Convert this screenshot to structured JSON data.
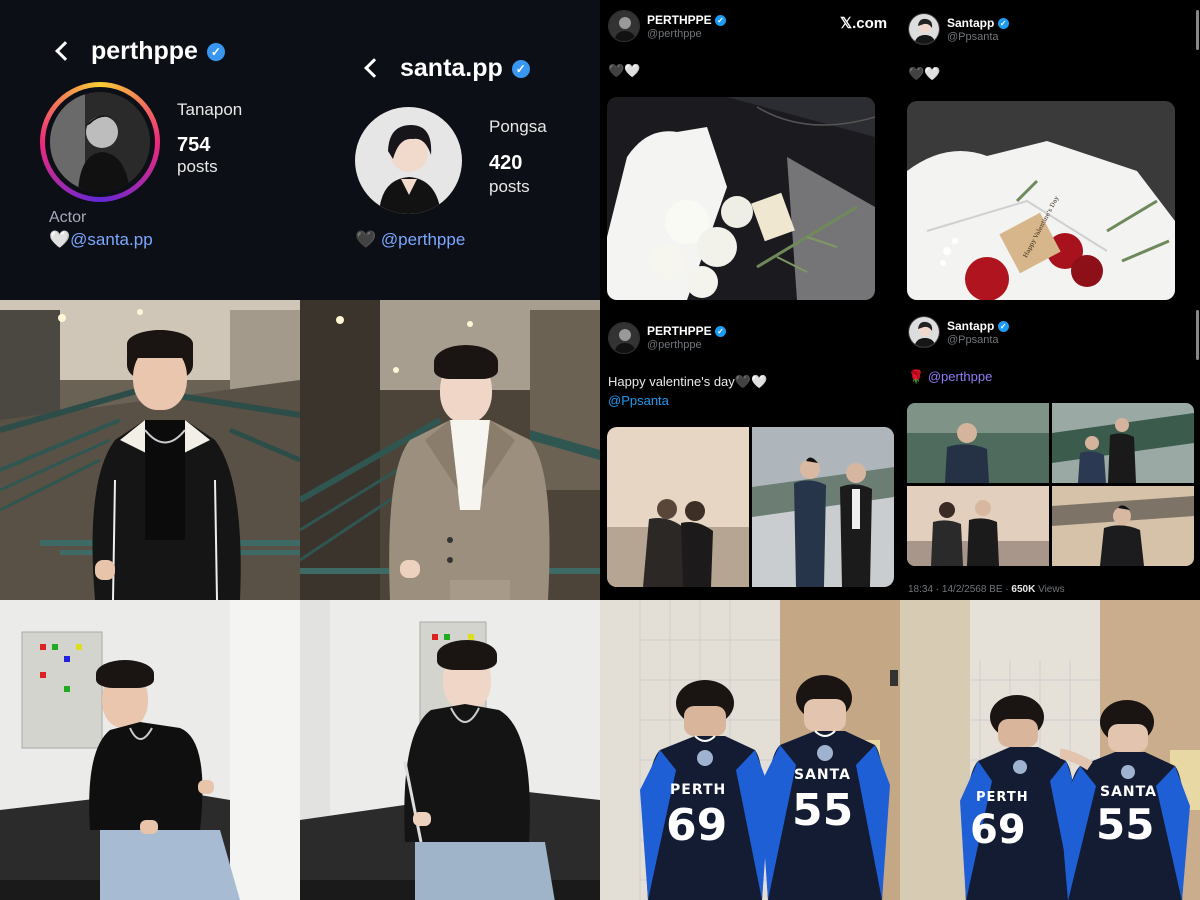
{
  "ig_left": {
    "username": "perthppe",
    "full_name": "Tanapon",
    "posts_count": "754",
    "posts_label": "posts",
    "bio": "Actor",
    "heart": "🤍",
    "mention": "@santa.pp"
  },
  "ig_right": {
    "username": "santa.pp",
    "full_name": "Pongsa",
    "posts_count": "420",
    "posts_label": "posts",
    "heart": "🖤",
    "mention": "@perthppe"
  },
  "tw_left": {
    "site_logo": "𝕏.com",
    "post1": {
      "name": "PERTHPPE",
      "handle": "@perthppe",
      "text": "🖤🤍"
    },
    "post2": {
      "name": "PERTHPPE",
      "handle": "@perthppe",
      "text": "Happy valentine's day🖤🤍",
      "link": "@Ppsanta"
    }
  },
  "tw_right": {
    "post1": {
      "name": "Santapp",
      "handle": "@Ppsanta",
      "text": "🖤🤍"
    },
    "post2": {
      "name": "Santapp",
      "handle": "@Ppsanta",
      "emoji": "🌹",
      "link": "@perthppe",
      "time": "18:34 · 14/2/2568 BE · ",
      "views_count": "650K",
      "views_label": " Views"
    }
  },
  "jerseys": {
    "left": {
      "name": "PERTH",
      "number": "69"
    },
    "right": {
      "name": "SANTA",
      "number": "55"
    }
  },
  "gift_tag": "Happy Valentine's Day",
  "colors": {
    "verified": "#3897f0",
    "ig_bg": "#0d0f16",
    "mention_ig": "#7aa7ff",
    "tw_link": "#1d9bf0",
    "jersey_blue": "#1f5fd6",
    "jersey_navy": "#141c33"
  },
  "icons": [
    "back-chevron-icon",
    "verified-badge-icon",
    "x-logo-icon"
  ]
}
